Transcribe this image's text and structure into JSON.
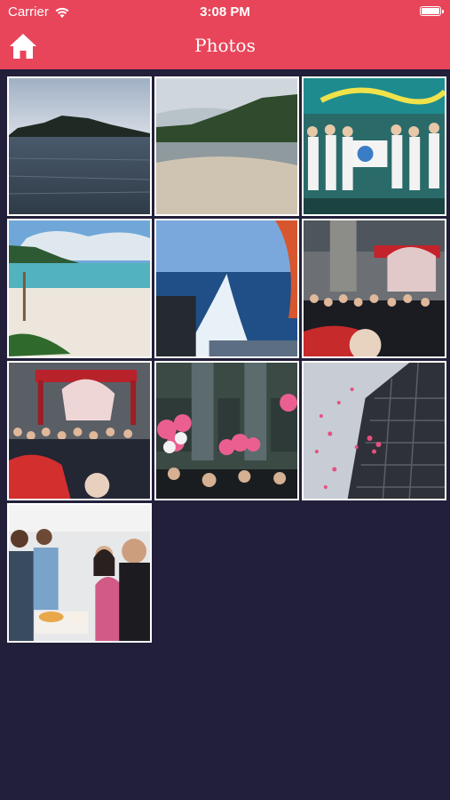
{
  "status": {
    "carrier": "Carrier",
    "time": "3:08 PM"
  },
  "nav": {
    "title": "Photos",
    "home_icon": "home-icon"
  },
  "colors": {
    "accent": "#e8455a",
    "background": "#221f3a"
  },
  "photos": [
    {
      "subject": "island-sea"
    },
    {
      "subject": "beach-shore"
    },
    {
      "subject": "event-stage-group"
    },
    {
      "subject": "tropical-beach"
    },
    {
      "subject": "boat-wake"
    },
    {
      "subject": "lion-dance-crowd"
    },
    {
      "subject": "lion-dance-ceremony"
    },
    {
      "subject": "balloon-crowd"
    },
    {
      "subject": "balloons-building"
    },
    {
      "subject": "office-selfie"
    }
  ]
}
